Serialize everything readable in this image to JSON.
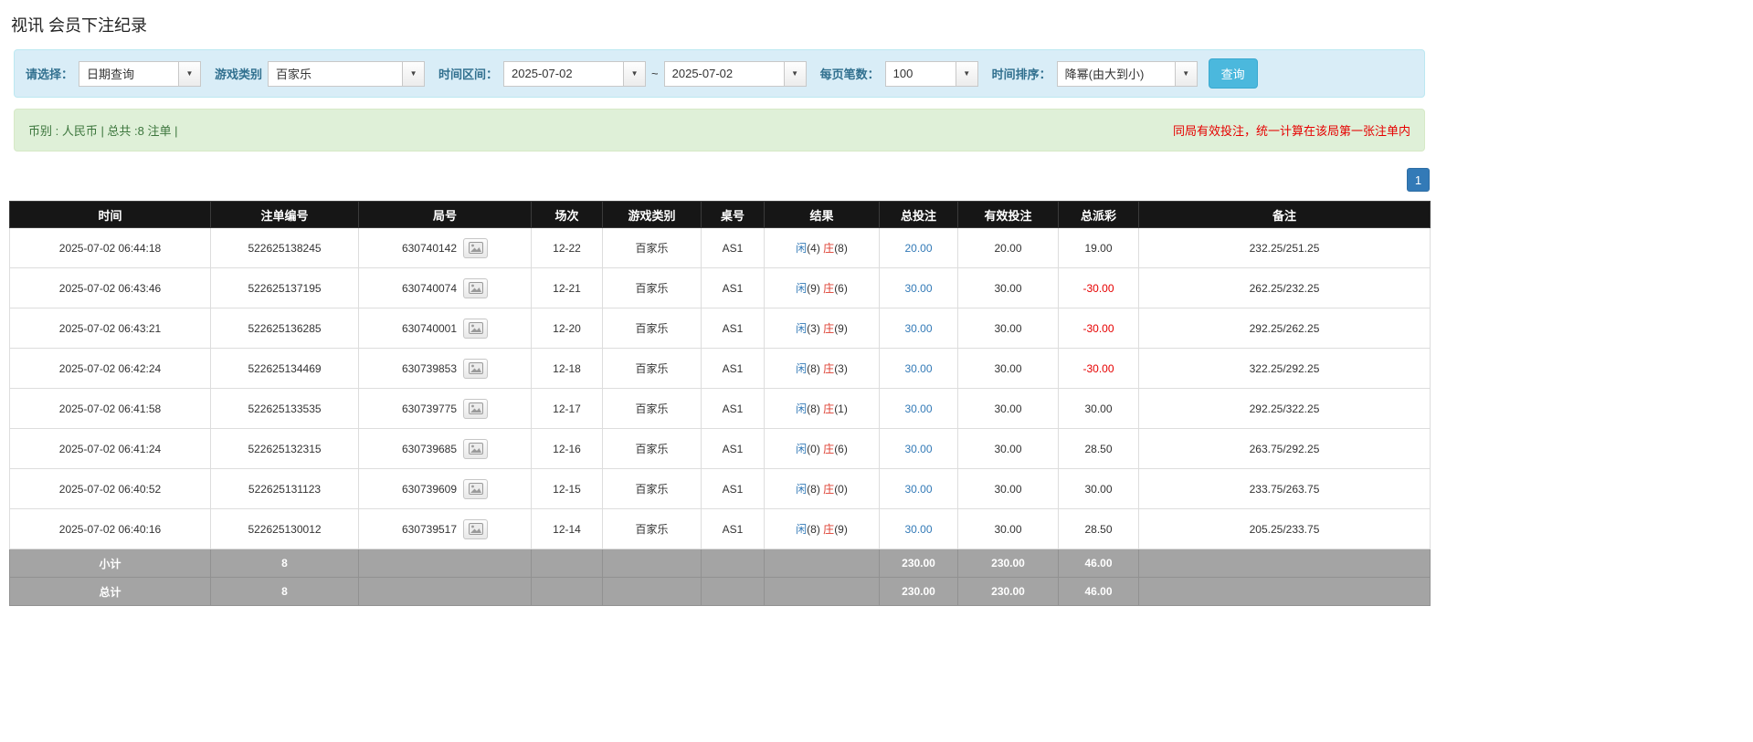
{
  "colors": {
    "player_blue": "#337ab7",
    "banker_red": "#dd3c2e",
    "link_blue": "#337ab7",
    "negative_red": "#e60000",
    "header_bg": "#161616",
    "footer_bg": "#a4a4a4",
    "search_button_bg": "#4bb8dd"
  },
  "page": {
    "title": "视讯 会员下注纪录"
  },
  "filters": {
    "select_label": "请选择：",
    "select_value": "日期查询",
    "game_type_label": "游戏类别",
    "game_type_value": "百家乐",
    "time_range_label": "时间区间：",
    "date_from": "2025-07-02",
    "range_separator": "~",
    "date_to": "2025-07-02",
    "page_size_label": "每页笔数：",
    "page_size_value": "100",
    "sort_label": "时间排序：",
    "sort_value": "降幂(由大到小)",
    "search_button": "查询"
  },
  "summary": {
    "left": "币别 : 人民币 | 总共 :8 注单 |",
    "right": "同局有效投注，统一计算在该局第一张注单内"
  },
  "pagination": {
    "current_page": "1"
  },
  "table": {
    "headers": [
      "时间",
      "注单编号",
      "局号",
      "场次",
      "游戏类别",
      "桌号",
      "结果",
      "总投注",
      "有效投注",
      "总派彩",
      "备注"
    ],
    "rows": [
      {
        "time": "2025-07-02 06:44:18",
        "bet_id": "522625138245",
        "round_id": "630740142",
        "session": "12-22",
        "game": "百家乐",
        "table_no": "AS1",
        "result_player": "闲",
        "result_player_n": "(4)",
        "result_banker": "庄",
        "result_banker_n": "(8)",
        "total_bet": "20.00",
        "valid_bet": "20.00",
        "payout": "19.00",
        "remark": "232.25/251.25"
      },
      {
        "time": "2025-07-02 06:43:46",
        "bet_id": "522625137195",
        "round_id": "630740074",
        "session": "12-21",
        "game": "百家乐",
        "table_no": "AS1",
        "result_player": "闲",
        "result_player_n": "(9)",
        "result_banker": "庄",
        "result_banker_n": "(6)",
        "total_bet": "30.00",
        "valid_bet": "30.00",
        "payout": "-30.00",
        "remark": "262.25/232.25"
      },
      {
        "time": "2025-07-02 06:43:21",
        "bet_id": "522625136285",
        "round_id": "630740001",
        "session": "12-20",
        "game": "百家乐",
        "table_no": "AS1",
        "result_player": "闲",
        "result_player_n": "(3)",
        "result_banker": "庄",
        "result_banker_n": "(9)",
        "total_bet": "30.00",
        "valid_bet": "30.00",
        "payout": "-30.00",
        "remark": "292.25/262.25"
      },
      {
        "time": "2025-07-02 06:42:24",
        "bet_id": "522625134469",
        "round_id": "630739853",
        "session": "12-18",
        "game": "百家乐",
        "table_no": "AS1",
        "result_player": "闲",
        "result_player_n": "(8)",
        "result_banker": "庄",
        "result_banker_n": "(3)",
        "total_bet": "30.00",
        "valid_bet": "30.00",
        "payout": "-30.00",
        "remark": "322.25/292.25"
      },
      {
        "time": "2025-07-02 06:41:58",
        "bet_id": "522625133535",
        "round_id": "630739775",
        "session": "12-17",
        "game": "百家乐",
        "table_no": "AS1",
        "result_player": "闲",
        "result_player_n": "(8)",
        "result_banker": "庄",
        "result_banker_n": "(1)",
        "total_bet": "30.00",
        "valid_bet": "30.00",
        "payout": "30.00",
        "remark": "292.25/322.25"
      },
      {
        "time": "2025-07-02 06:41:24",
        "bet_id": "522625132315",
        "round_id": "630739685",
        "session": "12-16",
        "game": "百家乐",
        "table_no": "AS1",
        "result_player": "闲",
        "result_player_n": "(0)",
        "result_banker": "庄",
        "result_banker_n": "(6)",
        "total_bet": "30.00",
        "valid_bet": "30.00",
        "payout": "28.50",
        "remark": "263.75/292.25"
      },
      {
        "time": "2025-07-02 06:40:52",
        "bet_id": "522625131123",
        "round_id": "630739609",
        "session": "12-15",
        "game": "百家乐",
        "table_no": "AS1",
        "result_player": "闲",
        "result_player_n": "(8)",
        "result_banker": "庄",
        "result_banker_n": "(0)",
        "total_bet": "30.00",
        "valid_bet": "30.00",
        "payout": "30.00",
        "remark": "233.75/263.75"
      },
      {
        "time": "2025-07-02 06:40:16",
        "bet_id": "522625130012",
        "round_id": "630739517",
        "session": "12-14",
        "game": "百家乐",
        "table_no": "AS1",
        "result_player": "闲",
        "result_player_n": "(8)",
        "result_banker": "庄",
        "result_banker_n": "(9)",
        "total_bet": "30.00",
        "valid_bet": "30.00",
        "payout": "28.50",
        "remark": "205.25/233.75"
      }
    ],
    "footer_rows": [
      {
        "label": "小计",
        "count": "8",
        "total_bet": "230.00",
        "valid_bet": "230.00",
        "payout": "46.00"
      },
      {
        "label": "总计",
        "count": "8",
        "total_bet": "230.00",
        "valid_bet": "230.00",
        "payout": "46.00"
      }
    ]
  }
}
